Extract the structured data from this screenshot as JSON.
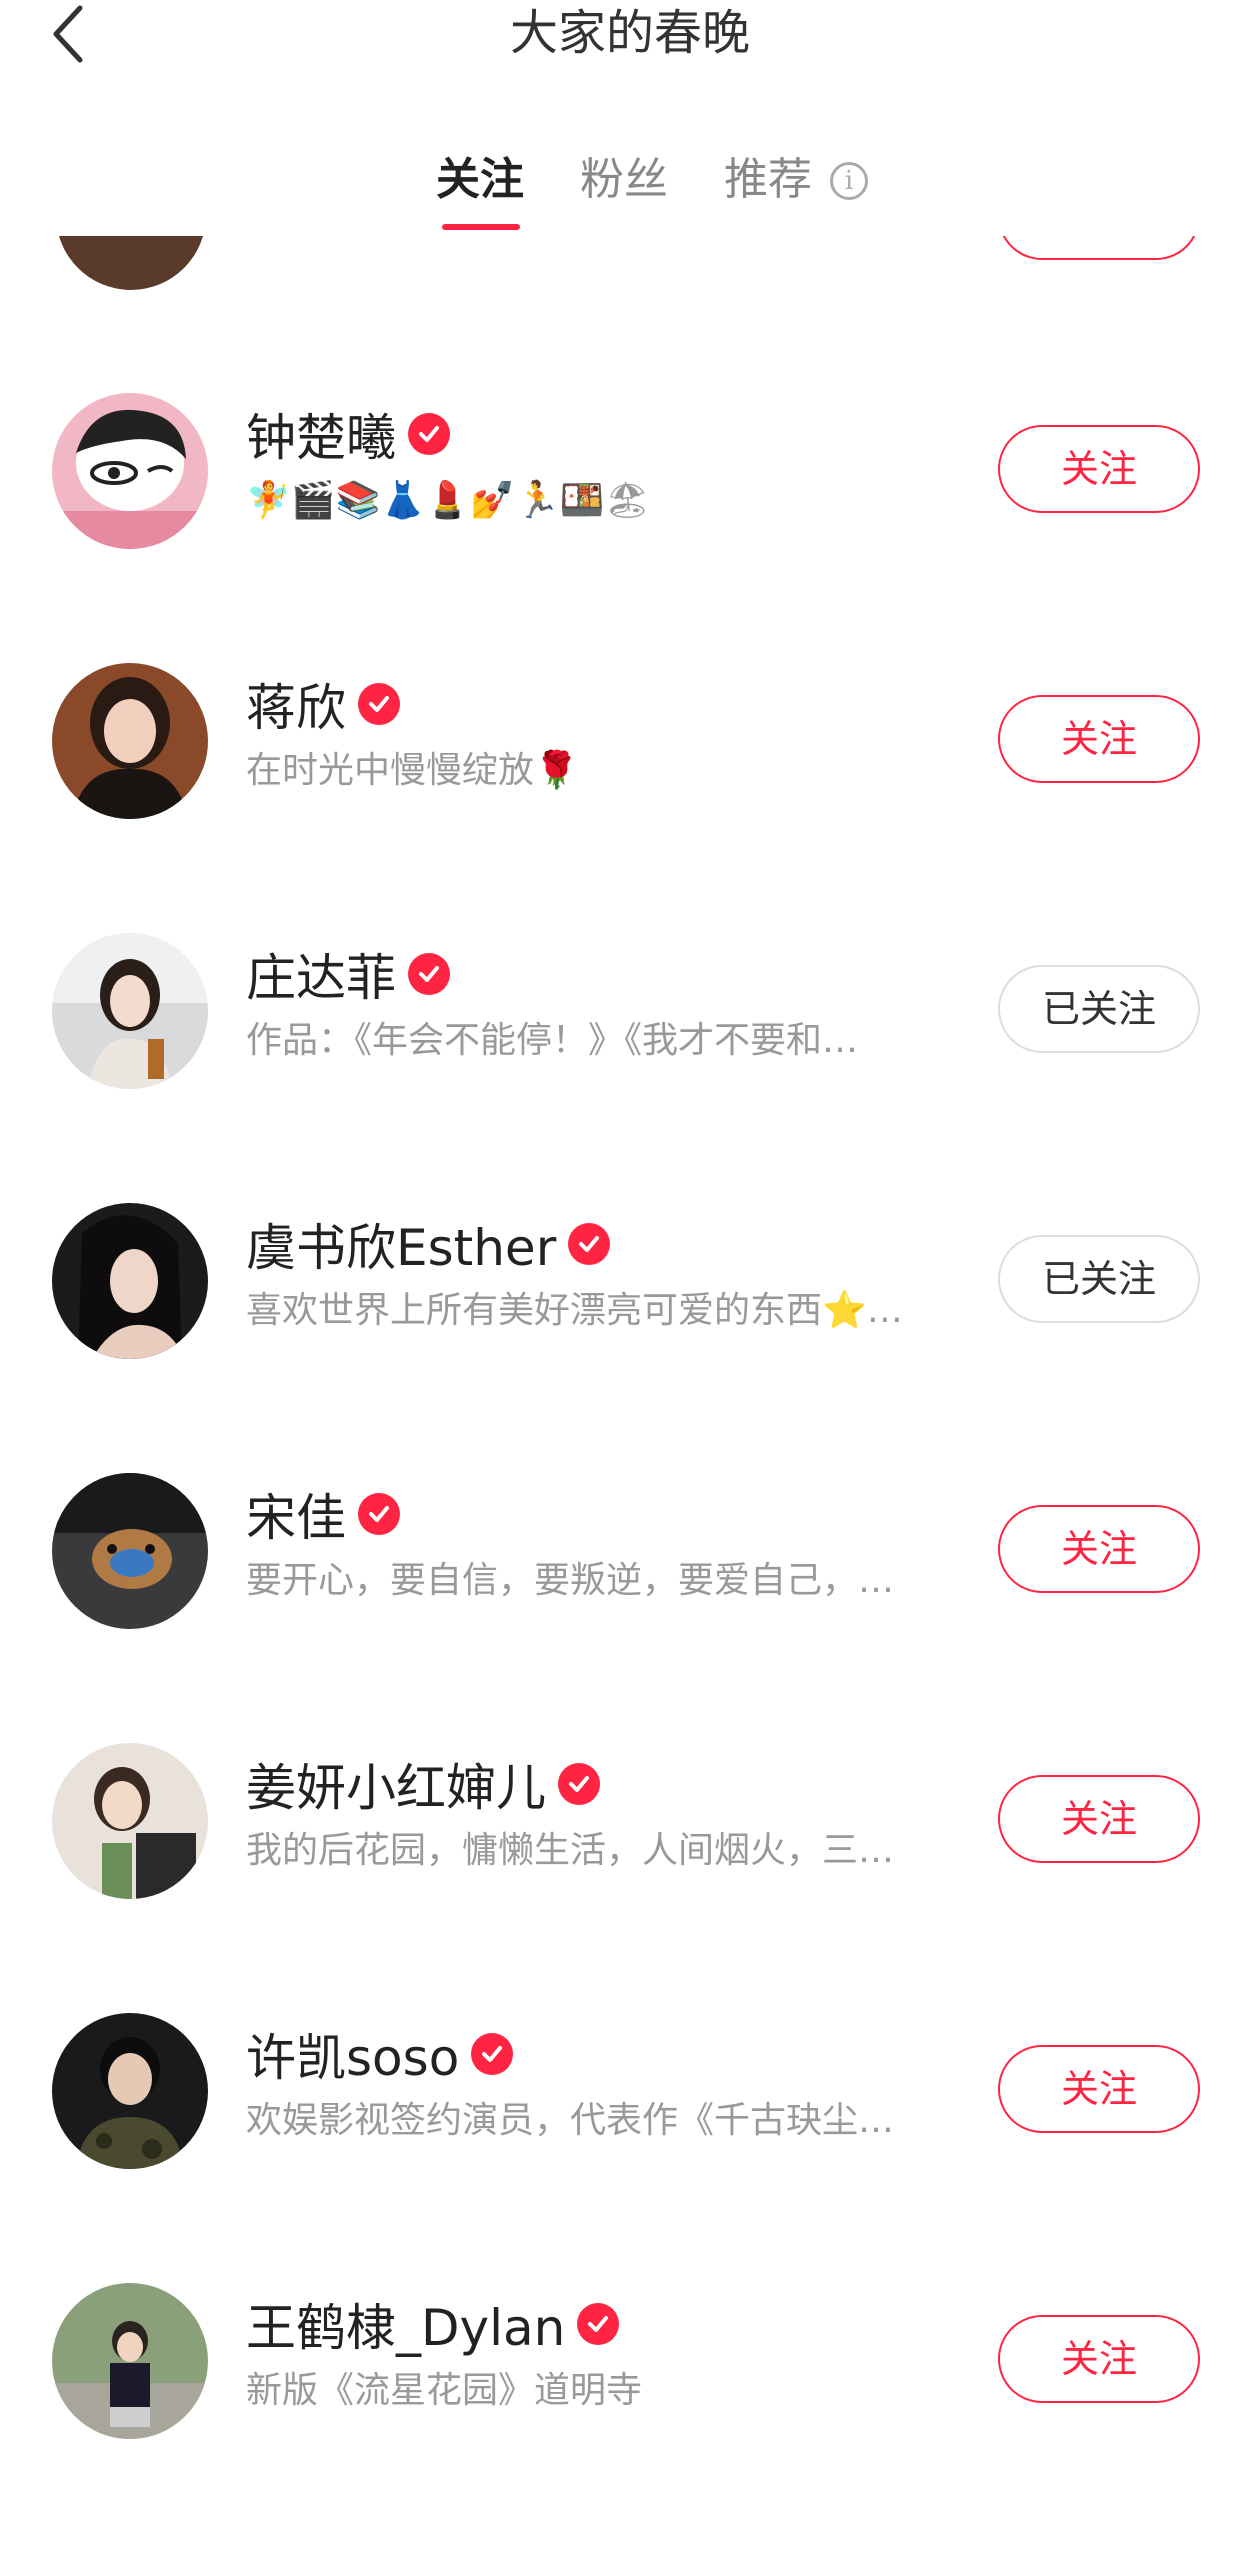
{
  "header": {
    "title": "大家的春晚",
    "back_icon": "chevron-left-icon"
  },
  "tabs": [
    {
      "label": "关注",
      "active": true
    },
    {
      "label": "粉丝",
      "active": false
    },
    {
      "label": "推荐",
      "active": false
    }
  ],
  "tab_info_icon": "info-icon",
  "colors": {
    "accent": "#ff2442",
    "text_primary": "#222222",
    "text_secondary": "#999999"
  },
  "users": [
    {
      "name": "钟楚曦",
      "verified": true,
      "desc": "🧚🎬📚👗💄💅🏃🍱🏖",
      "button": "关注",
      "followed": false
    },
    {
      "name": "蒋欣",
      "verified": true,
      "desc": "在时光中慢慢绽放🌹",
      "button": "关注",
      "followed": false
    },
    {
      "name": "庄达菲",
      "verified": true,
      "desc": "作品：《年会不能停！》《我才不要和…",
      "button": "已关注",
      "followed": true
    },
    {
      "name": "虞书欣Esther",
      "verified": true,
      "desc": "喜欢世界上所有美好漂亮可爱的东西⭐…",
      "button": "已关注",
      "followed": true
    },
    {
      "name": "宋佳",
      "verified": true,
      "desc": "要开心，要自信，要叛逆，要爱自己，…",
      "button": "关注",
      "followed": false
    },
    {
      "name": "姜妍小红婶儿",
      "verified": true,
      "desc": "我的后花园，慵懒生活，人间烟火，三…",
      "button": "关注",
      "followed": false
    },
    {
      "name": "许凯soso",
      "verified": true,
      "desc": "欢娱影视签约演员，代表作《千古玦尘…",
      "button": "关注",
      "followed": false
    },
    {
      "name": "王鹤棣_Dylan",
      "verified": true,
      "desc": "新版《流星花园》道明寺",
      "button": "关注",
      "followed": false
    }
  ]
}
